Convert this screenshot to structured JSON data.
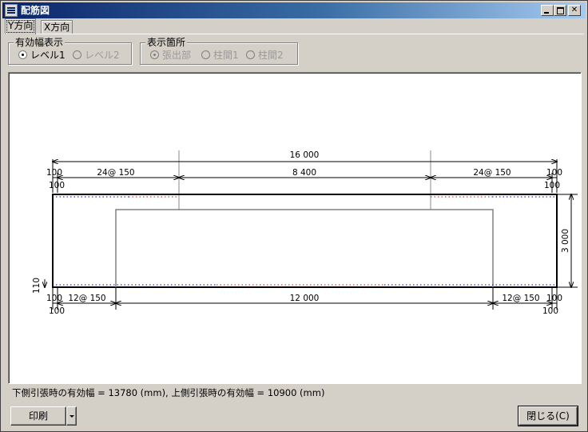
{
  "window": {
    "title": "配筋図",
    "icon": "rebar-app-icon"
  },
  "tabs": [
    {
      "label": "Y方向",
      "active": true
    },
    {
      "label": "X方向",
      "active": false
    }
  ],
  "effective_width_display": {
    "legend": "有効幅表示",
    "options": [
      {
        "label": "レベル1",
        "checked": true,
        "enabled": true
      },
      {
        "label": "レベル2",
        "checked": false,
        "enabled": false
      }
    ]
  },
  "display_location": {
    "legend": "表示箇所",
    "options": [
      {
        "label": "張出部",
        "checked": true,
        "enabled": false
      },
      {
        "label": "柱間1",
        "checked": false,
        "enabled": false
      },
      {
        "label": "柱間2",
        "checked": false,
        "enabled": false
      }
    ]
  },
  "drawing": {
    "top_total": "16 000",
    "top_left_edge": "100",
    "top_left_edge_sub": "100",
    "top_left_span": "24@ 150",
    "top_center_span": "8 400",
    "top_right_span": "24@ 150",
    "top_right_edge": "100",
    "top_right_edge_sub": "100",
    "height": "3 000",
    "bottom_cover": "110",
    "bottom_left_edge": "100",
    "bottom_left_edge_sub": "100",
    "bottom_left_span": "12@ 150",
    "bottom_center_span": "12 000",
    "bottom_right_span": "12@ 150",
    "bottom_right_edge": "100",
    "bottom_right_edge_sub": "100",
    "colors": {
      "dotted_blue": "#3030c0",
      "dotted_red": "#d04040",
      "outline": "#000000",
      "inner": "#808080"
    }
  },
  "status": "下側引張時の有効幅 = 13780 (mm),  上側引張時の有効幅 = 10900 (mm)",
  "buttons": {
    "print": "印刷",
    "close": "閉じる(C)"
  }
}
